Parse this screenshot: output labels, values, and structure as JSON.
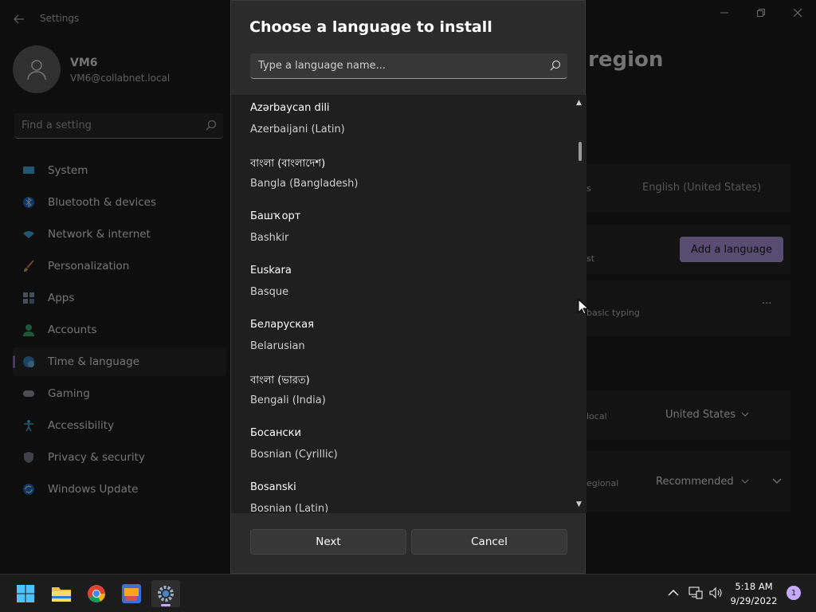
{
  "app": {
    "title": "Settings",
    "page_title_fragment": "region"
  },
  "profile": {
    "name": "VM6",
    "email": "VM6@collabnet.local"
  },
  "sidebar": {
    "search_placeholder": "Find a setting",
    "items": [
      {
        "label": "System",
        "icon": "system-icon",
        "selected": false
      },
      {
        "label": "Bluetooth & devices",
        "icon": "bluetooth-icon",
        "selected": false
      },
      {
        "label": "Network & internet",
        "icon": "wifi-icon",
        "selected": false
      },
      {
        "label": "Personalization",
        "icon": "brush-icon",
        "selected": false
      },
      {
        "label": "Apps",
        "icon": "apps-icon",
        "selected": false
      },
      {
        "label": "Accounts",
        "icon": "accounts-icon",
        "selected": false
      },
      {
        "label": "Time & language",
        "icon": "globe-clock-icon",
        "selected": true
      },
      {
        "label": "Gaming",
        "icon": "gamepad-icon",
        "selected": false
      },
      {
        "label": "Accessibility",
        "icon": "accessibility-icon",
        "selected": false
      },
      {
        "label": "Privacy & security",
        "icon": "shield-icon",
        "selected": false
      },
      {
        "label": "Windows Update",
        "icon": "update-icon",
        "selected": false
      }
    ]
  },
  "background_content": {
    "frag_s": "s",
    "display_language_value": "English (United States)",
    "frag_st": "st",
    "add_language_label": "Add a language",
    "basic_typing_frag": "basic typing",
    "more_label": "···",
    "local_frag": "local",
    "country_value": "United States",
    "regional_frag": "egional",
    "format_value": "Recommended"
  },
  "modal": {
    "title": "Choose a language to install",
    "search_placeholder": "Type a language name...",
    "languages": [
      {
        "native": "Azərbaycan dili",
        "english": "Azerbaijani (Latin)"
      },
      {
        "native": "বাংলা (বাংলাদেশ)",
        "english": "Bangla (Bangladesh)"
      },
      {
        "native": "Башҡорт",
        "english": "Bashkir"
      },
      {
        "native": "Euskara",
        "english": "Basque"
      },
      {
        "native": "Беларуская",
        "english": "Belarusian"
      },
      {
        "native": "বাংলা (ভারত)",
        "english": "Bengali (India)"
      },
      {
        "native": "Босански",
        "english": "Bosnian (Cyrillic)"
      },
      {
        "native": "Bosanski",
        "english": "Bosnian (Latin)"
      }
    ],
    "next_label": "Next",
    "cancel_label": "Cancel"
  },
  "taskbar": {
    "apps": [
      "windows-start-icon",
      "file-explorer-icon",
      "chrome-icon",
      "game-app-icon",
      "settings-gear-icon"
    ],
    "time": "5:18 AM",
    "date": "9/29/2022",
    "notification_count": "1"
  },
  "colors": {
    "accent": "#c5a8ff",
    "window_bg": "#202020",
    "modal_bg": "#2b2b2b"
  }
}
